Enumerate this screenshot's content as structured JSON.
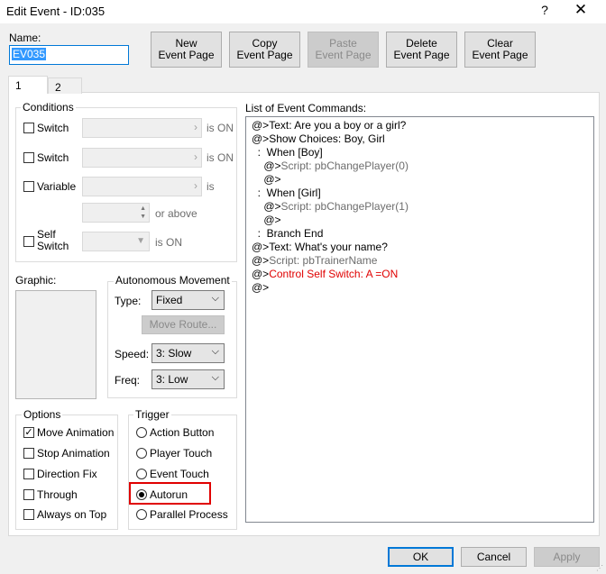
{
  "window": {
    "title": "Edit Event - ID:035",
    "help_glyph": "?",
    "close_glyph": "✕"
  },
  "name": {
    "label": "Name:",
    "value": "EV035"
  },
  "toolbar": {
    "new_page": "New\nEvent Page",
    "copy_page": "Copy\nEvent Page",
    "paste_page": "Paste\nEvent Page",
    "delete_page": "Delete\nEvent Page",
    "clear_page": "Clear\nEvent Page"
  },
  "tabs": [
    {
      "label": "1"
    },
    {
      "label": "2"
    }
  ],
  "conditions": {
    "title": "Conditions",
    "switch1": "Switch",
    "switch1_suffix": "is ON",
    "switch2": "Switch",
    "switch2_suffix": "is ON",
    "variable": "Variable",
    "variable_suffix": "is",
    "or_above": "or above",
    "self_switch": "Self\nSwitch",
    "self_switch_suffix": "is ON",
    "combo_arrow": "›"
  },
  "graphic": {
    "label": "Graphic:"
  },
  "movement": {
    "title": "Autonomous Movement",
    "type_label": "Type:",
    "type_value": "Fixed",
    "move_route": "Move Route...",
    "speed_label": "Speed:",
    "speed_value": "3: Slow",
    "freq_label": "Freq:",
    "freq_value": "3: Low"
  },
  "options": {
    "title": "Options",
    "items": [
      {
        "label": "Move Animation",
        "checked": true
      },
      {
        "label": "Stop Animation",
        "checked": false
      },
      {
        "label": "Direction Fix",
        "checked": false
      },
      {
        "label": "Through",
        "checked": false
      },
      {
        "label": "Always on Top",
        "checked": false
      }
    ]
  },
  "trigger": {
    "title": "Trigger",
    "items": [
      {
        "label": "Action Button",
        "selected": false
      },
      {
        "label": "Player Touch",
        "selected": false
      },
      {
        "label": "Event Touch",
        "selected": false
      },
      {
        "label": "Autorun",
        "selected": true
      },
      {
        "label": "Parallel Process",
        "selected": false
      }
    ]
  },
  "commands": {
    "label": "List of Event Commands:",
    "lines": [
      {
        "prefix": "@>",
        "text": "Text: Are you a boy or a girl?",
        "style": "normal"
      },
      {
        "prefix": "@>",
        "text": "Show Choices: Boy, Girl",
        "style": "normal"
      },
      {
        "prefix": "  :  ",
        "text": "When [Boy]",
        "style": "normal"
      },
      {
        "prefix": "    @>",
        "text": "Script: pbChangePlayer(0)",
        "style": "gray"
      },
      {
        "prefix": "    @>",
        "text": "",
        "style": "normal"
      },
      {
        "prefix": "  :  ",
        "text": "When [Girl]",
        "style": "normal"
      },
      {
        "prefix": "    @>",
        "text": "Script: pbChangePlayer(1)",
        "style": "gray"
      },
      {
        "prefix": "    @>",
        "text": "",
        "style": "normal"
      },
      {
        "prefix": "  :  ",
        "text": "Branch End",
        "style": "normal"
      },
      {
        "prefix": "@>",
        "text": "Text: What's your name?",
        "style": "normal"
      },
      {
        "prefix": "@>",
        "text": "Script: pbTrainerName",
        "style": "gray"
      },
      {
        "prefix": "@>",
        "text": "Control Self Switch: A =ON",
        "style": "red"
      },
      {
        "prefix": "@>",
        "text": "",
        "style": "normal"
      }
    ]
  },
  "footer": {
    "ok": "OK",
    "cancel": "Cancel",
    "apply": "Apply"
  }
}
